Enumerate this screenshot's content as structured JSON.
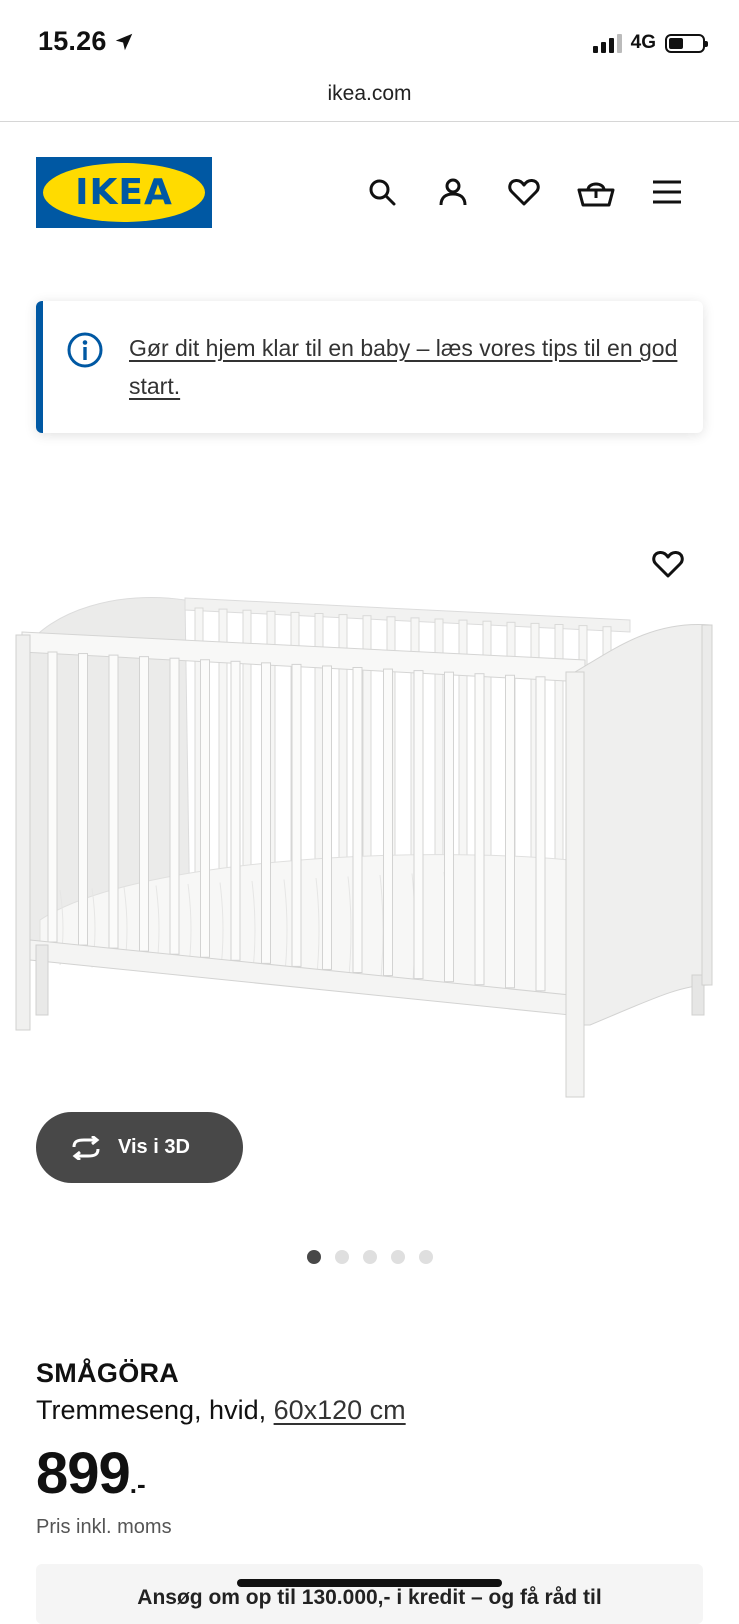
{
  "status_bar": {
    "time": "15.26",
    "network": "4G"
  },
  "browser": {
    "url": "ikea.com"
  },
  "header": {
    "logo_text": "IKEA",
    "icons": [
      "search-icon",
      "account-icon",
      "favourites-icon",
      "basket-icon",
      "menu-icon"
    ]
  },
  "banner": {
    "text": "Gør dit hjem klar til en baby – læs vores tips til en god start."
  },
  "gallery": {
    "view_3d_label": "Vis i 3D",
    "image_count": 5,
    "active_index": 0
  },
  "product": {
    "name": "SMÅGÖRA",
    "description": "Tremmeseng, hvid, ",
    "size": "60x120 cm",
    "price_integer": "899",
    "price_suffix": ".-",
    "price_note": "Pris inkl. moms"
  },
  "credit": {
    "text": "Ansøg om op til 130.000,- i kredit – og få råd til"
  },
  "colors": {
    "ikea_blue": "#0058a3",
    "ikea_yellow": "#ffdb00",
    "button_dark": "#484848"
  }
}
